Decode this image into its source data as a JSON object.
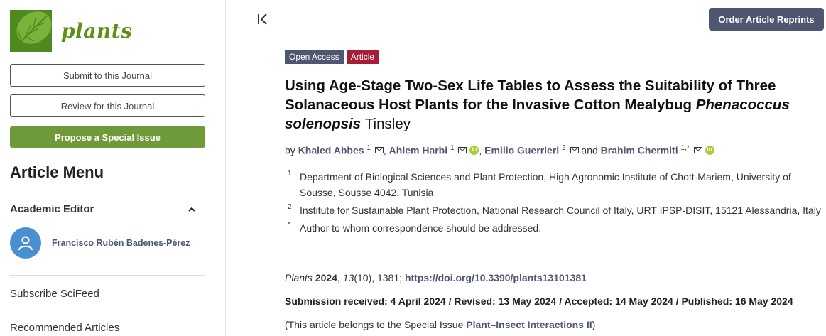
{
  "journal": {
    "name": "plants"
  },
  "sidebar": {
    "submit_label": "Submit to this Journal",
    "review_label": "Review for this Journal",
    "propose_label": "Propose a Special Issue",
    "menu_title": "Article Menu",
    "academic_editor_label": "Academic Editor",
    "editor_name": "Francisco Rubén Badenes-Pérez",
    "links": [
      "Subscribe SciFeed",
      "Recommended Articles"
    ]
  },
  "toolbar": {
    "order_reprints_label": "Order Article Reprints"
  },
  "article": {
    "badges": [
      "Open Access",
      "Article"
    ],
    "title_main": "Using Age-Stage Two-Sex Life Tables to Assess the Suitability of Three Solanaceous Host Plants for the Invasive Cotton Mealybug",
    "title_species": "Phenacoccus solenopsis",
    "title_tail": "Tinsley",
    "by": "by",
    "authors": [
      {
        "name": "Khaled Abbes",
        "sup": "1"
      },
      {
        "name": "Ahlem Harbi",
        "sup": "1"
      },
      {
        "name": "Emilio Guerrieri",
        "sup": "2"
      },
      {
        "name": "Brahim Chermiti",
        "sup": "1,*"
      }
    ],
    "and": "and",
    "affiliations": [
      {
        "num": "1",
        "text": "Department of Biological Sciences and Plant Protection, High Agronomic Institute of Chott-Mariem, University of Sousse, Sousse 4042, Tunisia"
      },
      {
        "num": "2",
        "text": "Institute for Sustainable Plant Protection, National Research Council of Italy, URT IPSP-DISIT, 15121 Alessandria, Italy"
      },
      {
        "num": "*",
        "text": "Author to whom correspondence should be addressed."
      }
    ],
    "citation": {
      "journal": "Plants",
      "year": "2024",
      "volume": "13",
      "rest": "(10), 1381;",
      "doi": "https://doi.org/10.3390/plants13101381"
    },
    "dates": "Submission received: 4 April 2024 / Revised: 13 May 2024 / Accepted: 14 May 2024 / Published: 16 May 2024",
    "special_issue_prefix": "(This article belongs to the Special Issue",
    "special_issue_name": "Plant–Insect Interactions II",
    "special_issue_suffix": ")"
  }
}
